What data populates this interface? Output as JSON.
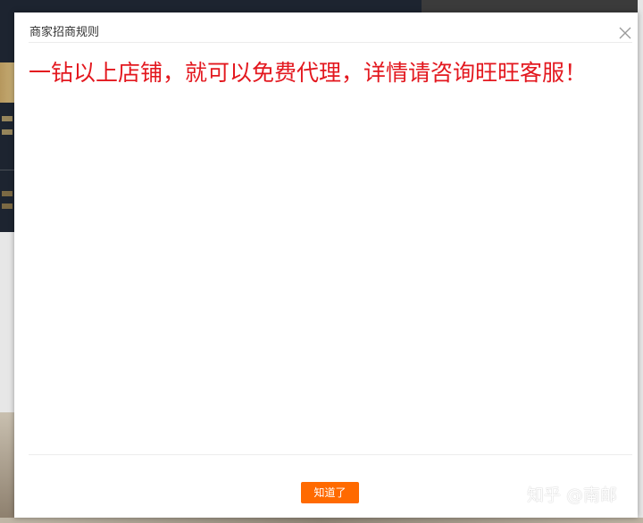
{
  "modal": {
    "title": "商家招商规则",
    "notice": "一钻以上店铺，就可以免费代理，详情请咨询旺旺客服！",
    "confirm_label": "知道了",
    "close_icon": "close-icon"
  },
  "watermark": {
    "text": "知乎 @南邮"
  },
  "colors": {
    "notice": "#e3181f",
    "button": "#ff6a00",
    "modal_bg": "#ffffff"
  }
}
